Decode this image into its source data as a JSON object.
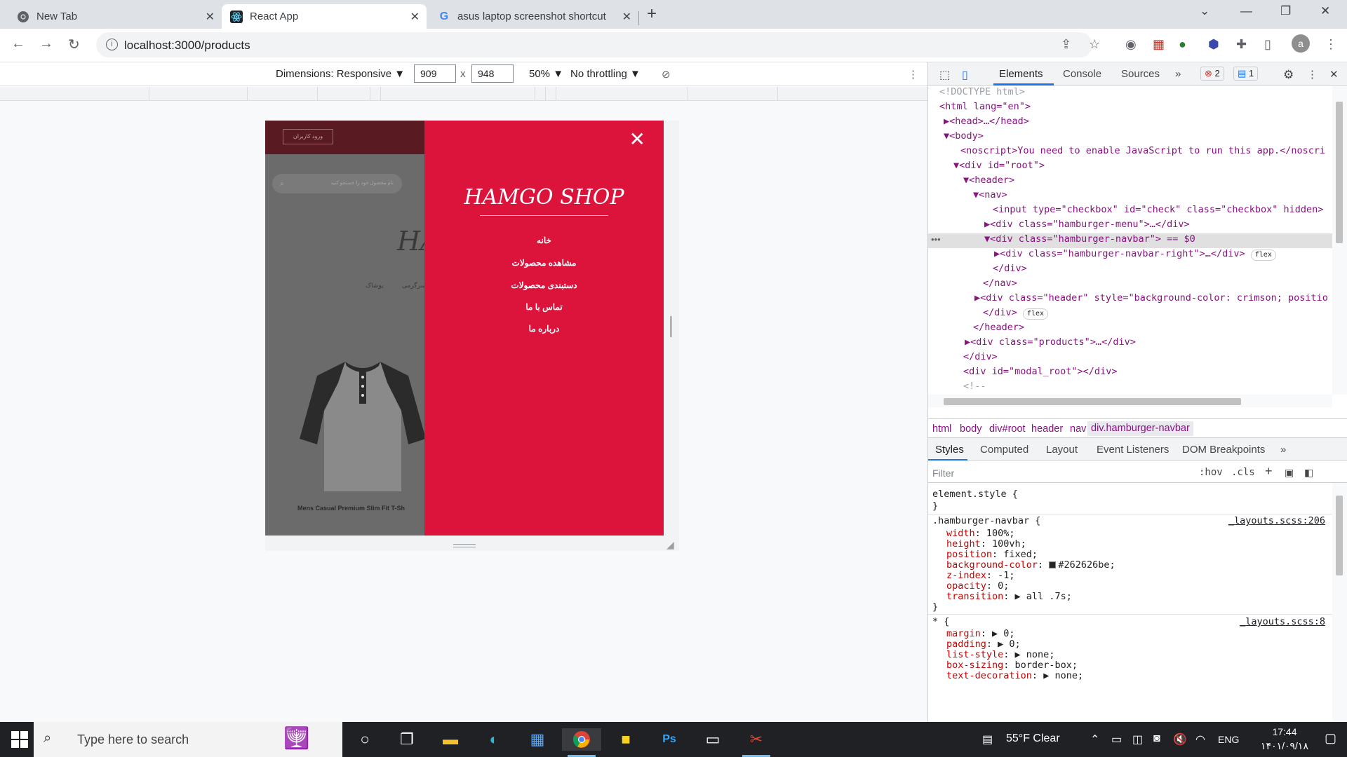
{
  "browser": {
    "tabs": [
      {
        "title": "New Tab",
        "icon": "chrome-icon"
      },
      {
        "title": "React App",
        "icon": "react-icon"
      },
      {
        "title": "asus laptop screenshot shortcut",
        "icon": "google-icon"
      }
    ],
    "url": "localhost:3000/products"
  },
  "device_toolbar": {
    "dimensions_label": "Dimensions: Responsive ▼",
    "width": "909",
    "height": "948",
    "times": "x",
    "zoom": "50% ▼",
    "throttling": "No throttling ▼"
  },
  "site": {
    "login_button": "ورود کاربران",
    "search_placeholder": "نام محصول خود را جستجو کنید",
    "bg_logo": "HA",
    "bg_categories": [
      "پوشاک",
      "سرگرمی"
    ],
    "product_name": "Mens Casual Premium Slim Fit T-Sh",
    "drawer": {
      "close": "✕",
      "title": "HAMGO SHOP",
      "menu": [
        "خانه",
        "مشاهده محصولات",
        "دستبندی محصولات",
        "تماس با ما",
        "درباره ما"
      ]
    }
  },
  "devtools": {
    "tabs": [
      "Elements",
      "Console",
      "Sources",
      "»"
    ],
    "errors": "2",
    "messages": "1",
    "dom_lines": [
      {
        "t": "<!DOCTYPE html>"
      },
      {
        "t": "<html lang=\"en\">"
      },
      {
        "t": "▶<head>…</head>"
      },
      {
        "t": "▼<body>"
      },
      {
        "t": "<noscript>You need to enable JavaScript to run this app.</noscri"
      },
      {
        "t": "▼<div id=\"root\">"
      },
      {
        "t": "▼<header>"
      },
      {
        "t": "▼<nav>"
      },
      {
        "t": "<input type=\"checkbox\" id=\"check\" class=\"checkbox\" hidden>"
      },
      {
        "t": "▶<div class=\"hamburger-menu\">…</div>"
      },
      {
        "t": "▼<div class=\"hamburger-navbar\"> == $0"
      },
      {
        "t": "▶<div class=\"hamburger-navbar-right\">…</div>"
      },
      {
        "t": "</div>"
      },
      {
        "t": "</nav>"
      },
      {
        "t": "▶<div class=\"header\" style=\"background-color: crimson; positio"
      },
      {
        "t": "</div>"
      },
      {
        "t": "</header>"
      },
      {
        "t": "▶<div class=\"products\">…</div>"
      },
      {
        "t": "</div>"
      },
      {
        "t": "<div id=\"modal_root\"></div>"
      },
      {
        "t": "<!--"
      }
    ],
    "flex_badge": "flex",
    "dom_dots": "•••",
    "breadcrumbs": [
      "html",
      "body",
      "div#root",
      "header",
      "nav",
      "div.hamburger-navbar"
    ],
    "style_tabs": [
      "Styles",
      "Computed",
      "Layout",
      "Event Listeners",
      "DOM Breakpoints",
      "»"
    ],
    "filter_placeholder": "Filter",
    "filter_hov": ":hov",
    "filter_cls": ".cls",
    "element_style": "element.style {",
    "close_brace": "}",
    "rule1": {
      "selector": ".hamburger-navbar {",
      "source": "_layouts.scss:206",
      "props": [
        {
          "n": "width",
          "v": "100%;"
        },
        {
          "n": "height",
          "v": "100vh;"
        },
        {
          "n": "position",
          "v": "fixed;"
        },
        {
          "n": "background-color",
          "v": "#262626be;"
        },
        {
          "n": "z-index",
          "v": "-1;"
        },
        {
          "n": "opacity",
          "v": "0;"
        },
        {
          "n": "transition",
          "v": "▶ all .7s;"
        }
      ]
    },
    "rule2": {
      "selector": "* {",
      "source": "_layouts.scss:8",
      "props": [
        {
          "n": "margin",
          "v": "▶ 0;"
        },
        {
          "n": "padding",
          "v": "▶ 0;"
        },
        {
          "n": "list-style",
          "v": "▶ none;"
        },
        {
          "n": "box-sizing",
          "v": "border-box;"
        },
        {
          "n": "text-decoration",
          "v": "▶ none;"
        }
      ]
    }
  },
  "taskbar": {
    "search_text": "Type here to search",
    "weather": "55°F  Clear",
    "lang": "ENG",
    "time": "17:44",
    "date": "۱۴۰۱/۰۹/۱۸"
  },
  "colors": {
    "drawer": "#dc143c",
    "taskbar": "#202124",
    "accent": "#1a73e8"
  }
}
